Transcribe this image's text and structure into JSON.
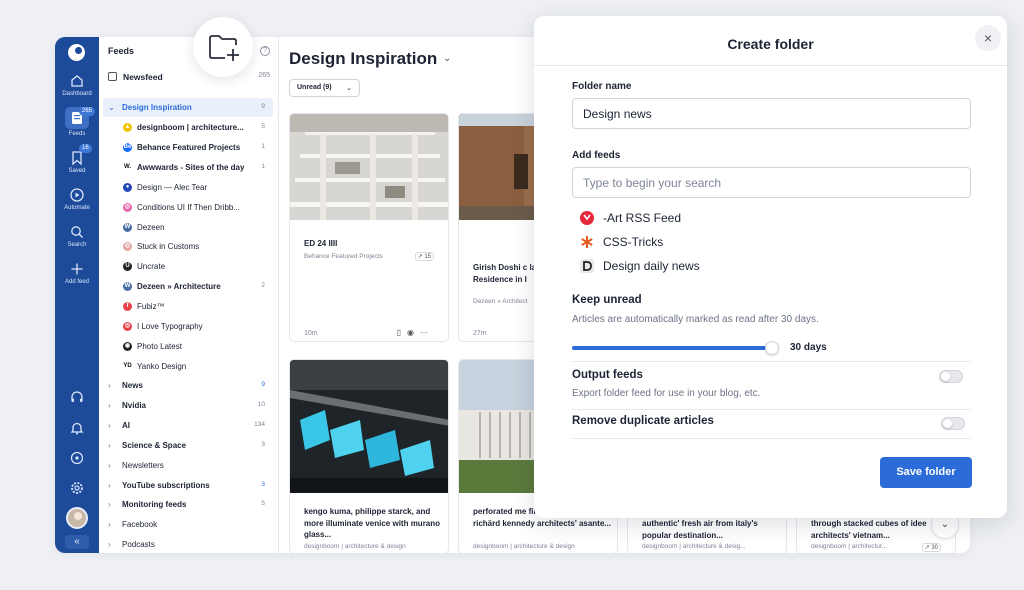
{
  "rail": {
    "items": [
      {
        "label": "Dashboard",
        "icon": "home-icon"
      },
      {
        "label": "Feeds",
        "icon": "feeds-icon",
        "badge": "265"
      },
      {
        "label": "Saved",
        "icon": "bookmark-icon",
        "badge": "16"
      },
      {
        "label": "Automate",
        "icon": "play-circle-icon"
      },
      {
        "label": "Search",
        "icon": "search-icon"
      },
      {
        "label": "Add feed",
        "icon": "plus-icon"
      }
    ],
    "collapse_label": "«"
  },
  "sidebar": {
    "title": "Feeds",
    "help": "?",
    "newsfeed": {
      "label": "Newsfeed",
      "count": "265"
    },
    "selected_folder": {
      "name": "Design Inspiration",
      "count": "9"
    },
    "feeds": [
      {
        "name": "designboom | architecture...",
        "count": "5",
        "bold": true,
        "color": "#f2c500",
        "glyph": "▲"
      },
      {
        "name": "Behance Featured Projects",
        "count": "1",
        "bold": true,
        "color": "#1769ff",
        "glyph": "Bē"
      },
      {
        "name": "Awwwards - Sites of the day",
        "count": "1",
        "bold": true,
        "color": "#ffffff",
        "glyph": "W."
      },
      {
        "name": "Design — Alec Tear",
        "count": "",
        "bold": false,
        "color": "#2347b8",
        "glyph": "●"
      },
      {
        "name": "Conditions UI If Then Dribb...",
        "count": "",
        "bold": false,
        "color": "#e867a6",
        "glyph": "◎"
      },
      {
        "name": "Dezeen",
        "count": "",
        "bold": false,
        "color": "#4a6fa5",
        "glyph": "W"
      },
      {
        "name": "Stuck in Customs",
        "count": "",
        "bold": false,
        "color": "#e2a6a6",
        "glyph": "◎"
      },
      {
        "name": "Uncrate",
        "count": "",
        "bold": false,
        "color": "#222222",
        "glyph": "U"
      },
      {
        "name": "Dezeen » Architecture",
        "count": "2",
        "bold": true,
        "color": "#4a6fa5",
        "glyph": "W"
      },
      {
        "name": "Fubiz™",
        "count": "",
        "bold": false,
        "color": "#e8434b",
        "glyph": "f"
      },
      {
        "name": "I Love Typography",
        "count": "",
        "bold": false,
        "color": "#e8434b",
        "glyph": "◎"
      },
      {
        "name": "Photo Latest",
        "count": "",
        "bold": false,
        "color": "#222222",
        "glyph": "◉"
      },
      {
        "name": "Yanko Design",
        "count": "",
        "bold": false,
        "color": "#ffffff",
        "glyph": "YD"
      }
    ],
    "folders": [
      {
        "name": "News",
        "count": "9",
        "bold": true,
        "blue": true
      },
      {
        "name": "Nvidia",
        "count": "10",
        "bold": true,
        "blue": false
      },
      {
        "name": "AI",
        "count": "134",
        "bold": true,
        "blue": false
      },
      {
        "name": "Science & Space",
        "count": "3",
        "bold": true,
        "blue": false
      },
      {
        "name": "Newsletters",
        "count": "",
        "bold": false,
        "blue": false
      },
      {
        "name": "YouTube subscriptions",
        "count": "3",
        "bold": true,
        "blue": true
      },
      {
        "name": "Monitoring feeds",
        "count": "5",
        "bold": true,
        "blue": false
      },
      {
        "name": "Facebook",
        "count": "",
        "bold": false,
        "blue": false
      },
      {
        "name": "Podcasts",
        "count": "",
        "bold": false,
        "blue": false
      }
    ]
  },
  "main": {
    "title": "Design Inspiration",
    "filter": "Unread (9)",
    "cards": [
      {
        "title": "ED 24 IIII",
        "source": "Behance Featured Projects",
        "stat": "↗ 15",
        "time": "10m"
      },
      {
        "title": "Girish Doshi c landscape of c Residence in I",
        "source": "Dezeen » Architect",
        "stat": "",
        "time": "27m"
      },
      {
        "title": "kengo kuma, philippe starck, and more illuminate venice with murano glass...",
        "source": "designboom | architecture & design",
        "stat": "",
        "time": ""
      },
      {
        "title": "perforated me filters light within richärd kennedy architects' asante...",
        "source": "designboom | architecture & design",
        "stat": "",
        "time": ""
      },
      {
        "title": "authentic' fresh air from italy's popular destination...",
        "source": "designboom | architecture & desig...",
        "stat": "",
        "time": ""
      },
      {
        "title": "through stacked cubes of idee architects' vietnam...",
        "source": "designboom | architectur...",
        "stat": "↗ 30",
        "time": ""
      }
    ]
  },
  "modal": {
    "title": "Create folder",
    "close": "×",
    "folder_name_label": "Folder name",
    "folder_name_value": "Design news",
    "add_feeds_label": "Add feeds",
    "add_feeds_placeholder": "Type to begin your search",
    "suggested_feeds": [
      {
        "name": "-Art RSS Feed",
        "icon": "rss-art-icon",
        "color": "#e8283c"
      },
      {
        "name": "CSS-Tricks",
        "icon": "asterisk-icon",
        "color": "#e85a1f"
      },
      {
        "name": "Design daily news",
        "icon": "letter-d-icon",
        "color": "#222222"
      }
    ],
    "keep_unread": {
      "title": "Keep unread",
      "description": "Articles are automatically marked as read after 30 days.",
      "value": "30 days",
      "fraction": 1.0
    },
    "output_feeds": {
      "title": "Output feeds",
      "description": "Export folder feed for use in your blog, etc.",
      "enabled": false
    },
    "remove_duplicates": {
      "title": "Remove duplicate articles",
      "enabled": false
    },
    "save_label": "Save folder",
    "accent": "#2b6cd8"
  }
}
